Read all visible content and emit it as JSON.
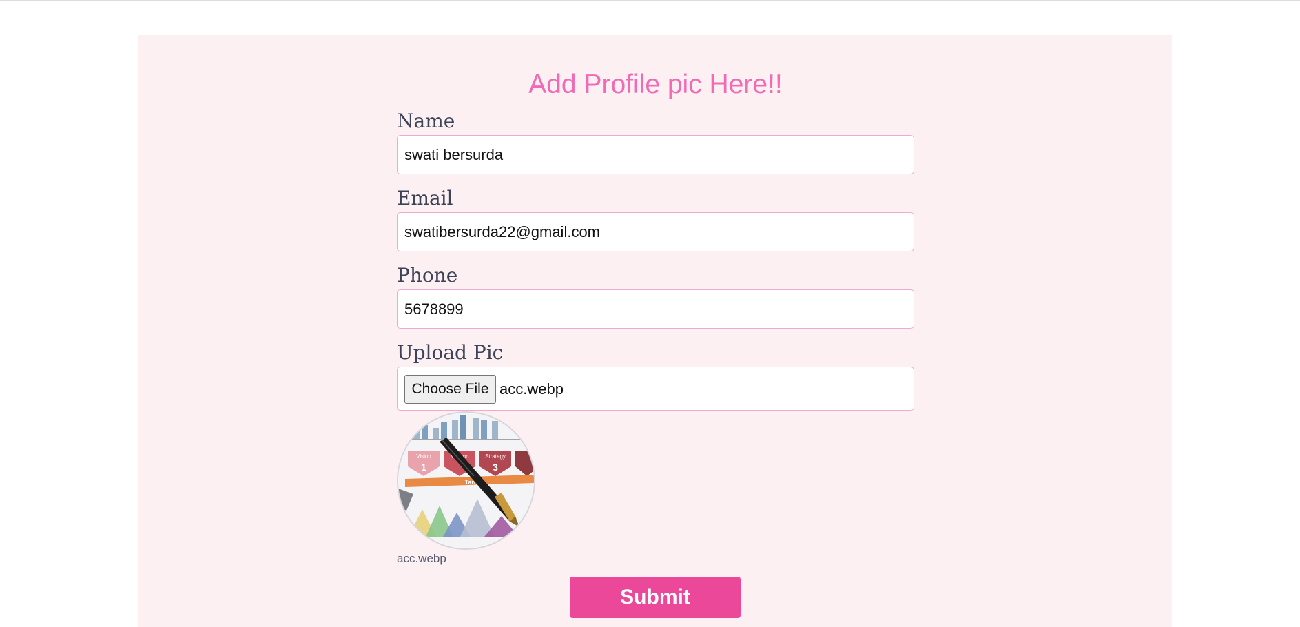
{
  "form": {
    "title": "Add Profile pic Here!!",
    "name": {
      "label": "Name",
      "value": "swati bersurda"
    },
    "email": {
      "label": "Email",
      "value": "swatibersurda22@gmail.com"
    },
    "phone": {
      "label": "Phone",
      "value": "5678899"
    },
    "upload": {
      "label": "Upload Pic",
      "button_label": "Choose File",
      "file_name": "acc.webp"
    },
    "preview": {
      "caption": "acc.webp",
      "image_text": [
        "Vision",
        "Mission",
        "Strategy",
        "Target"
      ],
      "image_numbers": [
        "1",
        "3"
      ]
    },
    "submit_label": "Submit"
  },
  "colors": {
    "panel_bg": "#fdf0f2",
    "title": "#f06ab5",
    "label": "#3c4257",
    "field_border": "#f2a9cf",
    "submit_bg": "#ec4899"
  }
}
